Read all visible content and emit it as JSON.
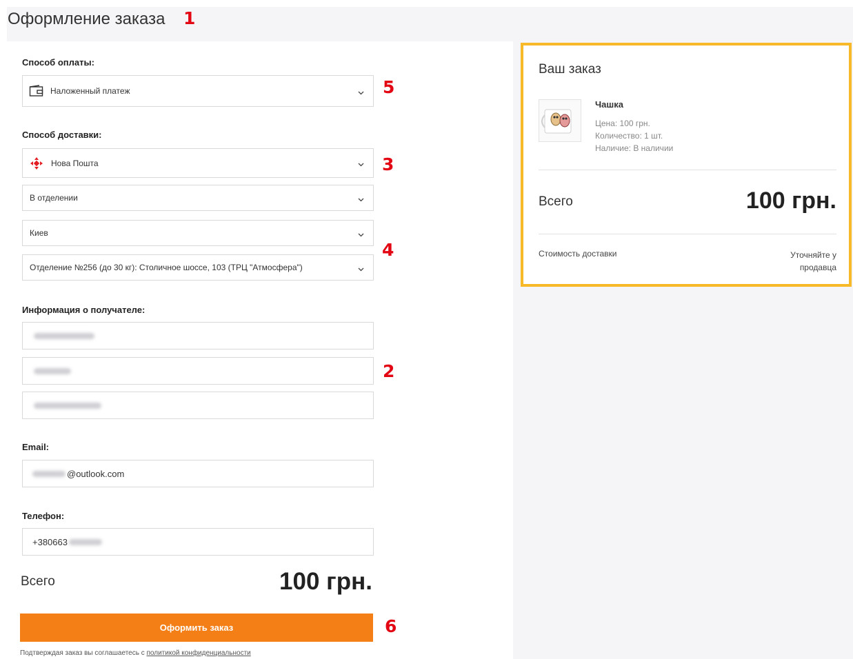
{
  "page": {
    "title": "Оформление заказа"
  },
  "markers": {
    "m1": "1",
    "m2": "2",
    "m3": "3",
    "m4": "4",
    "m5": "5",
    "m6": "6"
  },
  "payment": {
    "label": "Способ оплаты:",
    "selected": "Наложенный платеж",
    "icon": "wallet-icon"
  },
  "delivery": {
    "label": "Способ доставки:",
    "carrier": "Нова Пошта",
    "carrier_icon": "nova-poshta-logo",
    "type": "В отделении",
    "city": "Киев",
    "branch": "Отделение №256 (до 30 кг): Столичное шоссе, 103 (ТРЦ \"Атмосфера\")"
  },
  "recipient": {
    "label": "Информация о получателе:"
  },
  "email": {
    "label": "Email:",
    "visible_suffix": "@outlook.com"
  },
  "phone": {
    "label": "Телефон:",
    "visible_prefix": "+380663"
  },
  "bottom_total": {
    "label": "Всего",
    "amount": "100 грн."
  },
  "order_button": {
    "label": "Оформить заказ"
  },
  "privacy": {
    "text": "Подтверждая заказ вы соглашаетесь с ",
    "link": "политикой конфиденциальности"
  },
  "summary": {
    "title": "Ваш заказ",
    "item": {
      "name": "Чашка",
      "price": "Цена: 100 грн.",
      "quantity": "Количество: 1 шт.",
      "availability": "Наличие: В наличии"
    },
    "total_label": "Всего",
    "total_amount": "100 грн.",
    "shipping_label": "Стоимость доставки",
    "shipping_value": "Уточняйте у продавца"
  },
  "colors": {
    "accent": "#f47f16",
    "card_border": "#f7b928",
    "marker": "#e30613",
    "brand_red": "#e31e24"
  }
}
